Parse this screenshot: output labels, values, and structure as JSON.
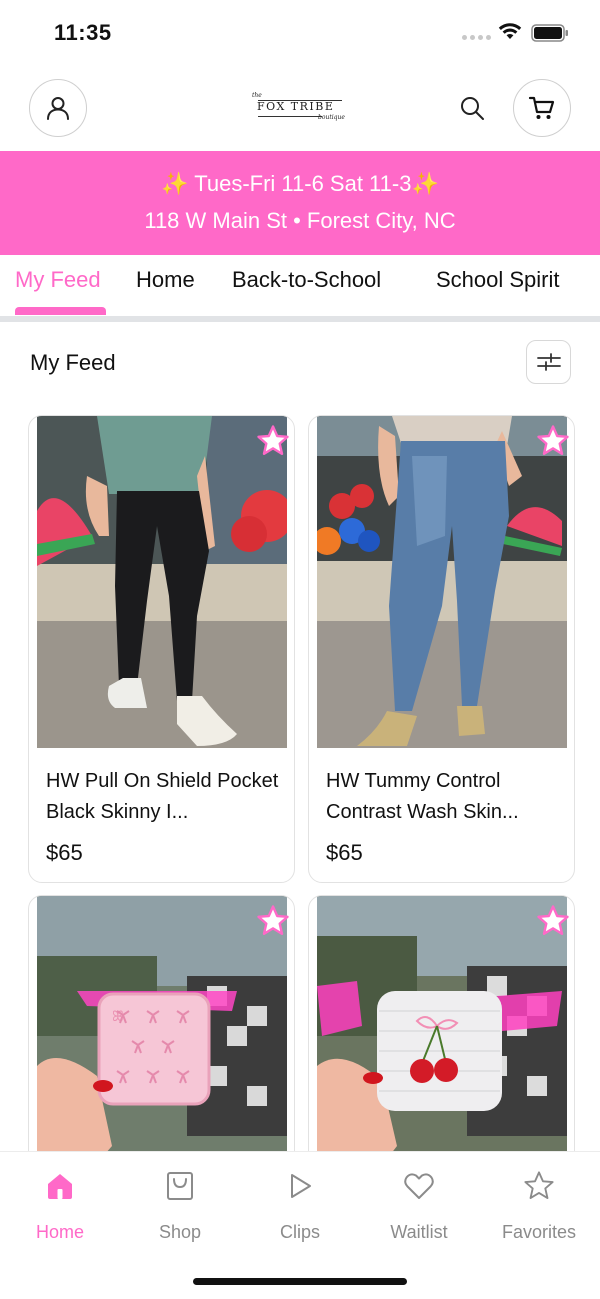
{
  "status_bar": {
    "time": "11:35"
  },
  "header": {
    "logo_small_top": "the",
    "logo_text": "FOX TRIBE",
    "logo_small_bottom": "boutique"
  },
  "banner": {
    "line1": "✨ Tues-Fri 11-6 Sat 11-3✨",
    "line2": "118 W Main St • Forest City, NC",
    "background_color": "#ff69c8"
  },
  "tabs": [
    {
      "label": "My Feed",
      "active": true
    },
    {
      "label": "Home",
      "active": false
    },
    {
      "label": "Back-to-School",
      "active": false
    },
    {
      "label": "School Spirit",
      "active": false
    }
  ],
  "section": {
    "title": "My Feed"
  },
  "products": [
    {
      "name": "HW Pull On Shield Pocket Black Skinny I...",
      "price": "$65",
      "image_description_icon": "black-skinny-jeans-photo"
    },
    {
      "name": "HW Tummy Control Contrast Wash Skin...",
      "price": "$65",
      "image_description_icon": "contrast-wash-jeans-photo"
    },
    {
      "name": "",
      "price": "",
      "image_description_icon": "pink-bow-jewelry-case-photo"
    },
    {
      "name": "",
      "price": "",
      "image_description_icon": "cherry-jewelry-case-photo"
    }
  ],
  "bottom_nav": [
    {
      "label": "Home",
      "icon": "home-icon",
      "active": true
    },
    {
      "label": "Shop",
      "icon": "shopping-bag-icon",
      "active": false
    },
    {
      "label": "Clips",
      "icon": "play-icon",
      "active": false
    },
    {
      "label": "Waitlist",
      "icon": "heart-icon",
      "active": false
    },
    {
      "label": "Favorites",
      "icon": "star-icon",
      "active": false
    }
  ],
  "colors": {
    "accent": "#ff69c8",
    "text": "#111111",
    "muted": "#8b8b8b"
  }
}
